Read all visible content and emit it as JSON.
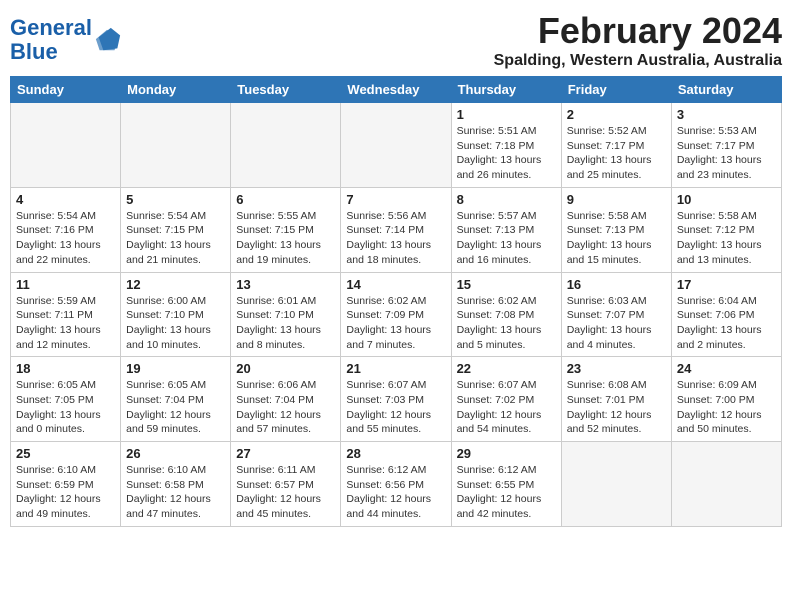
{
  "header": {
    "logo_line1": "General",
    "logo_line2": "Blue",
    "main_title": "February 2024",
    "subtitle": "Spalding, Western Australia, Australia"
  },
  "weekdays": [
    "Sunday",
    "Monday",
    "Tuesday",
    "Wednesday",
    "Thursday",
    "Friday",
    "Saturday"
  ],
  "weeks": [
    [
      {
        "day": "",
        "info": ""
      },
      {
        "day": "",
        "info": ""
      },
      {
        "day": "",
        "info": ""
      },
      {
        "day": "",
        "info": ""
      },
      {
        "day": "1",
        "info": "Sunrise: 5:51 AM\nSunset: 7:18 PM\nDaylight: 13 hours\nand 26 minutes."
      },
      {
        "day": "2",
        "info": "Sunrise: 5:52 AM\nSunset: 7:17 PM\nDaylight: 13 hours\nand 25 minutes."
      },
      {
        "day": "3",
        "info": "Sunrise: 5:53 AM\nSunset: 7:17 PM\nDaylight: 13 hours\nand 23 minutes."
      }
    ],
    [
      {
        "day": "4",
        "info": "Sunrise: 5:54 AM\nSunset: 7:16 PM\nDaylight: 13 hours\nand 22 minutes."
      },
      {
        "day": "5",
        "info": "Sunrise: 5:54 AM\nSunset: 7:15 PM\nDaylight: 13 hours\nand 21 minutes."
      },
      {
        "day": "6",
        "info": "Sunrise: 5:55 AM\nSunset: 7:15 PM\nDaylight: 13 hours\nand 19 minutes."
      },
      {
        "day": "7",
        "info": "Sunrise: 5:56 AM\nSunset: 7:14 PM\nDaylight: 13 hours\nand 18 minutes."
      },
      {
        "day": "8",
        "info": "Sunrise: 5:57 AM\nSunset: 7:13 PM\nDaylight: 13 hours\nand 16 minutes."
      },
      {
        "day": "9",
        "info": "Sunrise: 5:58 AM\nSunset: 7:13 PM\nDaylight: 13 hours\nand 15 minutes."
      },
      {
        "day": "10",
        "info": "Sunrise: 5:58 AM\nSunset: 7:12 PM\nDaylight: 13 hours\nand 13 minutes."
      }
    ],
    [
      {
        "day": "11",
        "info": "Sunrise: 5:59 AM\nSunset: 7:11 PM\nDaylight: 13 hours\nand 12 minutes."
      },
      {
        "day": "12",
        "info": "Sunrise: 6:00 AM\nSunset: 7:10 PM\nDaylight: 13 hours\nand 10 minutes."
      },
      {
        "day": "13",
        "info": "Sunrise: 6:01 AM\nSunset: 7:10 PM\nDaylight: 13 hours\nand 8 minutes."
      },
      {
        "day": "14",
        "info": "Sunrise: 6:02 AM\nSunset: 7:09 PM\nDaylight: 13 hours\nand 7 minutes."
      },
      {
        "day": "15",
        "info": "Sunrise: 6:02 AM\nSunset: 7:08 PM\nDaylight: 13 hours\nand 5 minutes."
      },
      {
        "day": "16",
        "info": "Sunrise: 6:03 AM\nSunset: 7:07 PM\nDaylight: 13 hours\nand 4 minutes."
      },
      {
        "day": "17",
        "info": "Sunrise: 6:04 AM\nSunset: 7:06 PM\nDaylight: 13 hours\nand 2 minutes."
      }
    ],
    [
      {
        "day": "18",
        "info": "Sunrise: 6:05 AM\nSunset: 7:05 PM\nDaylight: 13 hours\nand 0 minutes."
      },
      {
        "day": "19",
        "info": "Sunrise: 6:05 AM\nSunset: 7:04 PM\nDaylight: 12 hours\nand 59 minutes."
      },
      {
        "day": "20",
        "info": "Sunrise: 6:06 AM\nSunset: 7:04 PM\nDaylight: 12 hours\nand 57 minutes."
      },
      {
        "day": "21",
        "info": "Sunrise: 6:07 AM\nSunset: 7:03 PM\nDaylight: 12 hours\nand 55 minutes."
      },
      {
        "day": "22",
        "info": "Sunrise: 6:07 AM\nSunset: 7:02 PM\nDaylight: 12 hours\nand 54 minutes."
      },
      {
        "day": "23",
        "info": "Sunrise: 6:08 AM\nSunset: 7:01 PM\nDaylight: 12 hours\nand 52 minutes."
      },
      {
        "day": "24",
        "info": "Sunrise: 6:09 AM\nSunset: 7:00 PM\nDaylight: 12 hours\nand 50 minutes."
      }
    ],
    [
      {
        "day": "25",
        "info": "Sunrise: 6:10 AM\nSunset: 6:59 PM\nDaylight: 12 hours\nand 49 minutes."
      },
      {
        "day": "26",
        "info": "Sunrise: 6:10 AM\nSunset: 6:58 PM\nDaylight: 12 hours\nand 47 minutes."
      },
      {
        "day": "27",
        "info": "Sunrise: 6:11 AM\nSunset: 6:57 PM\nDaylight: 12 hours\nand 45 minutes."
      },
      {
        "day": "28",
        "info": "Sunrise: 6:12 AM\nSunset: 6:56 PM\nDaylight: 12 hours\nand 44 minutes."
      },
      {
        "day": "29",
        "info": "Sunrise: 6:12 AM\nSunset: 6:55 PM\nDaylight: 12 hours\nand 42 minutes."
      },
      {
        "day": "",
        "info": ""
      },
      {
        "day": "",
        "info": ""
      }
    ]
  ]
}
